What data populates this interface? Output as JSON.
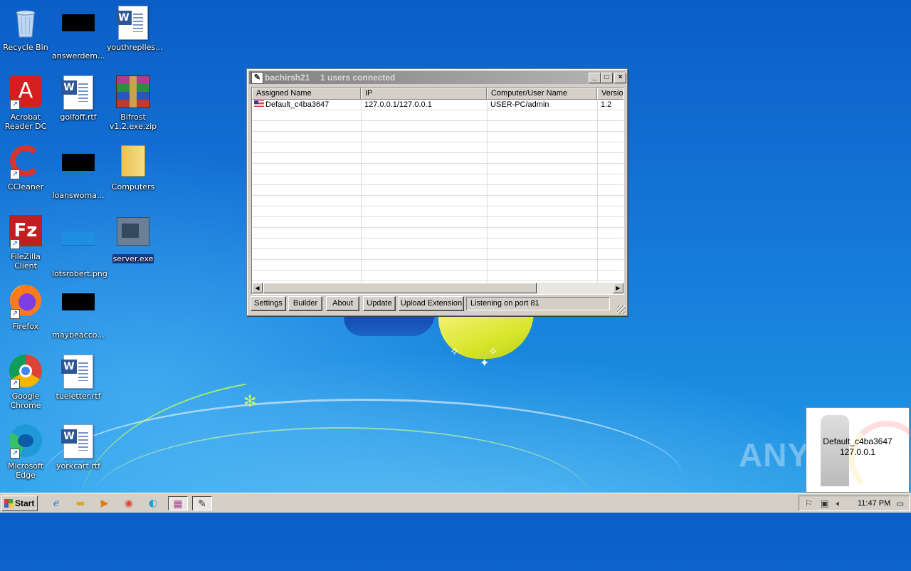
{
  "desktop": {
    "icons": [
      {
        "label": "Recycle Bin",
        "icon": "recycle-bin-icon"
      },
      {
        "label": "answerdem...",
        "icon": "black-thumbnail-icon"
      },
      {
        "label": "youthreplies...",
        "icon": "word-document-icon"
      },
      {
        "label": "Acrobat Reader DC",
        "icon": "acrobat-icon"
      },
      {
        "label": "golfoff.rtf",
        "icon": "word-document-icon"
      },
      {
        "label": "Bifrost v1.2.exe.zip",
        "icon": "winrar-archive-icon"
      },
      {
        "label": "CCleaner",
        "icon": "ccleaner-icon"
      },
      {
        "label": "loanswoma...",
        "icon": "black-thumbnail-icon"
      },
      {
        "label": "Computers",
        "icon": "folder-icon"
      },
      {
        "label": "FileZilla Client",
        "icon": "filezilla-icon"
      },
      {
        "label": "lotsrobert.png",
        "icon": "image-thumbnail-icon"
      },
      {
        "label": "server.exe",
        "icon": "executable-icon"
      },
      {
        "label": "Firefox",
        "icon": "firefox-icon"
      },
      {
        "label": "maybeacco...",
        "icon": "black-thumbnail-icon"
      },
      {
        "label": "Google Chrome",
        "icon": "chrome-icon"
      },
      {
        "label": "tueletter.rtf",
        "icon": "word-document-icon"
      },
      {
        "label": "Microsoft Edge",
        "icon": "edge-icon"
      },
      {
        "label": "yorkcart.rtf",
        "icon": "word-document-icon"
      }
    ]
  },
  "window": {
    "title": "bachirsh21",
    "subtitle": "1 users connected",
    "controls": {
      "minimize": "_",
      "maximize": "□",
      "close": "×"
    },
    "columns": [
      "Assigned Name",
      "IP",
      "Computer/User Name",
      "Versio"
    ],
    "rows": [
      {
        "name": "Default_c4ba3647",
        "ip": "127.0.0.1/127.0.0.1",
        "user": "USER-PC/admin",
        "version": "1.2"
      }
    ],
    "buttons": {
      "settings": "Settings",
      "builder": "Builder",
      "about": "About",
      "update": "Update",
      "upload": "Upload Extension"
    },
    "status": "Listening on port 81"
  },
  "notification": {
    "line1": "Default_c4ba3647",
    "line2": "127.0.0.1"
  },
  "watermark": "ANY RUN",
  "taskbar": {
    "start": "Start",
    "clock": "11:47 PM"
  }
}
